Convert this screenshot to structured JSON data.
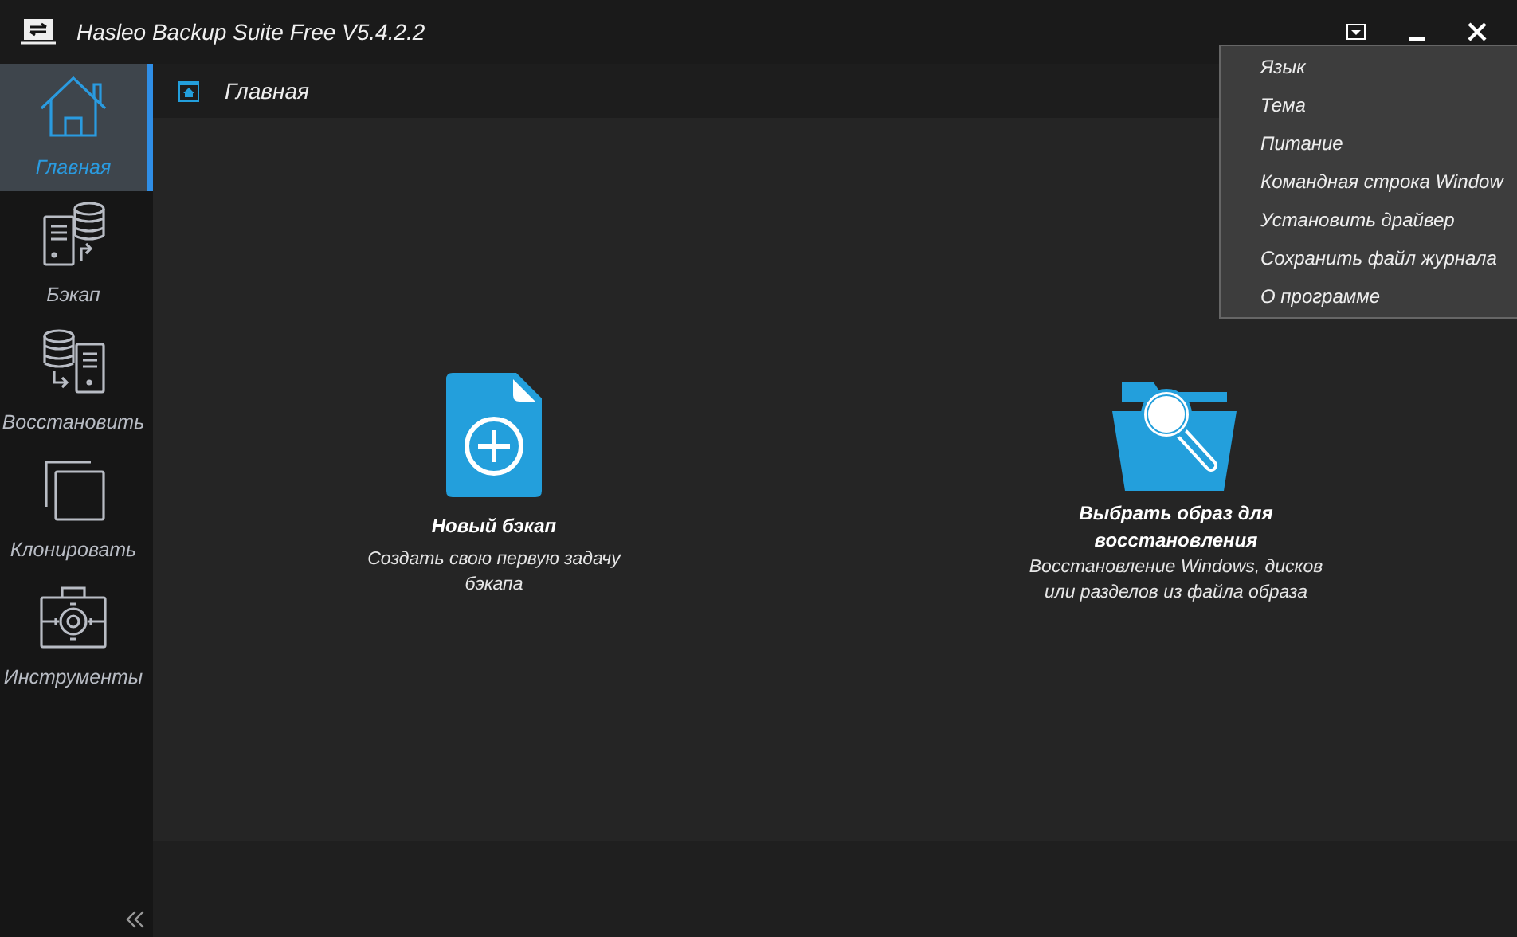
{
  "window": {
    "title": "Hasleo Backup Suite Free V5.4.2.2"
  },
  "sidebar": {
    "items": [
      {
        "label": "Главная",
        "selected": true
      },
      {
        "label": "Бэкап",
        "selected": false
      },
      {
        "label": "Восстановить",
        "selected": false
      },
      {
        "label": "Клонировать",
        "selected": false
      },
      {
        "label": "Инструменты",
        "selected": false
      }
    ]
  },
  "breadcrumb": "Главная",
  "actions": [
    {
      "title": "Новый бэкап",
      "description": "Создать свою первую задачу бэкапа"
    },
    {
      "title": "Выбрать образ для восстановления",
      "description": "Восстановление Windows, дисков или разделов из файла образа"
    }
  ],
  "menu": {
    "items": [
      "Язык",
      "Тема",
      "Питание",
      "Командная строка Window",
      "Установить драйвер",
      "Сохранить файл журнала",
      "О программе"
    ]
  }
}
